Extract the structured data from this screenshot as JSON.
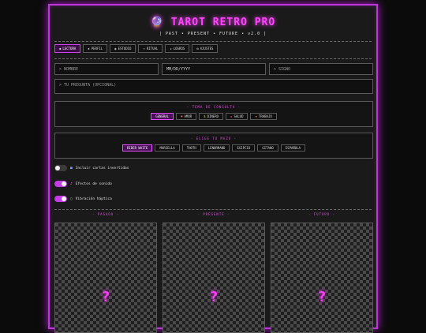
{
  "header": {
    "title": "TAROT RETRO PRO",
    "crystal_icon": "crystal-ball-icon",
    "subtitle": "[ PAST • PRESENT • FUTURE • v2.0 ]"
  },
  "tabs": [
    {
      "icon": "◆",
      "label": "LECTURA",
      "active": true
    },
    {
      "icon": "◈",
      "label": "PERFIL",
      "active": false
    },
    {
      "icon": "◉",
      "label": "ESTUDIO",
      "active": false
    },
    {
      "icon": "✦",
      "label": "RITUAL",
      "active": false
    },
    {
      "icon": "★",
      "label": "LOGROS",
      "active": false
    },
    {
      "icon": "⚙",
      "label": "AJUSTES",
      "active": false
    }
  ],
  "form": {
    "name_placeholder": "> NOMBRE",
    "date_placeholder": "MM/DD/YYYY",
    "sign_placeholder": "> SIGNO",
    "question_placeholder": "> TU PREGUNTA (OPCIONAL)"
  },
  "topics": {
    "title": "- TEMA DE CONSULTA -",
    "items": [
      {
        "icon": "",
        "label": "GENERAL",
        "active": true
      },
      {
        "icon": "♥",
        "label": "AMOR",
        "active": false
      },
      {
        "icon": "$",
        "label": "DINERO",
        "active": false
      },
      {
        "icon": "✚",
        "label": "SALUD",
        "active": false
      },
      {
        "icon": "⚒",
        "label": "TRABAJO",
        "active": false
      }
    ]
  },
  "decks": {
    "title": "- ELIGE TU MAZO -",
    "items": [
      {
        "label": "RIDER WAITE",
        "active": true
      },
      {
        "label": "MARSELLA",
        "active": false
      },
      {
        "label": "THOTH",
        "active": false
      },
      {
        "label": "LENORMAND",
        "active": false
      },
      {
        "label": "EGIPCIO",
        "active": false
      },
      {
        "label": "GITANO",
        "active": false
      },
      {
        "label": "ESPAÑOLA",
        "active": false
      }
    ]
  },
  "toggles": [
    {
      "icon": "■",
      "label": "Incluir cartas invertidas",
      "on": false
    },
    {
      "icon": "♪",
      "label": "Efectos de sonido",
      "on": true
    },
    {
      "icon": "▢",
      "label": "Vibración háptica",
      "on": true
    }
  ],
  "cards": [
    {
      "label": "- PASADO -",
      "symbol": "?"
    },
    {
      "label": "- PRESENTE -",
      "symbol": "?"
    },
    {
      "label": "- FUTURO -",
      "symbol": "?"
    }
  ],
  "colors": {
    "accent": "#c233e0",
    "accent_bright": "#ff44ff",
    "background": "#1a1a1a"
  }
}
